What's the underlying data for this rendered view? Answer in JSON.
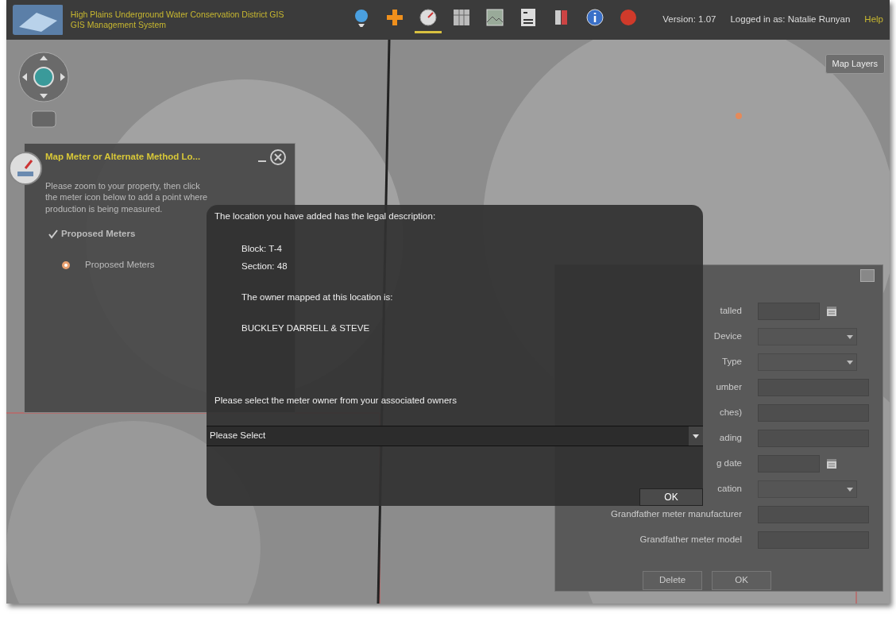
{
  "header": {
    "title_lines": [
      "High Plains Underground Water Conservation District GIS",
      "GIS Management System"
    ],
    "tools": [
      {
        "selected": false
      },
      {
        "selected": false
      },
      {
        "selected": true
      },
      {
        "selected": false
      },
      {
        "selected": false
      },
      {
        "selected": false
      },
      {
        "selected": false
      },
      {
        "selected": false
      },
      {
        "selected": false
      }
    ],
    "version": "Version: 1.07",
    "login": "Logged in as: Natalie Runyan",
    "help": "Help"
  },
  "map": {
    "layers_button": "Map Layers"
  },
  "meter_panel": {
    "title": "Map Meter or Alternate Method Lo...",
    "instructions": "Please zoom to your property, then click the meter icon below to add a point where production is being measured.",
    "layer": {
      "label": "Proposed Meters",
      "checked": true
    },
    "legend": [
      {
        "label": "Proposed Meters"
      }
    ]
  },
  "location_dialog": {
    "intro": "The location you have added has the legal description:",
    "block": "Block: T-4",
    "section": "Section: 48",
    "owner_intro": "The owner mapped at this location is:",
    "owner": "BUCKLEY DARRELL & STEVE",
    "prompt": "Please select the meter owner from your associated owners",
    "owner_select": {
      "value": "Please Select"
    },
    "ok": "OK"
  },
  "meter_form": {
    "fields": [
      {
        "label": "talled",
        "kind": "date"
      },
      {
        "label": "Device",
        "kind": "select"
      },
      {
        "label": "Type",
        "kind": "select"
      },
      {
        "label": "umber",
        "kind": "text"
      },
      {
        "label": "ches)",
        "kind": "text"
      },
      {
        "label": "ading",
        "kind": "text"
      },
      {
        "label": "g date",
        "kind": "date"
      },
      {
        "label": "cation",
        "kind": "select"
      },
      {
        "label": "Grandfather meter manufacturer",
        "kind": "text"
      },
      {
        "label": "Grandfather meter model",
        "kind": "text"
      }
    ],
    "buttons": [
      "Delete",
      "OK"
    ]
  }
}
